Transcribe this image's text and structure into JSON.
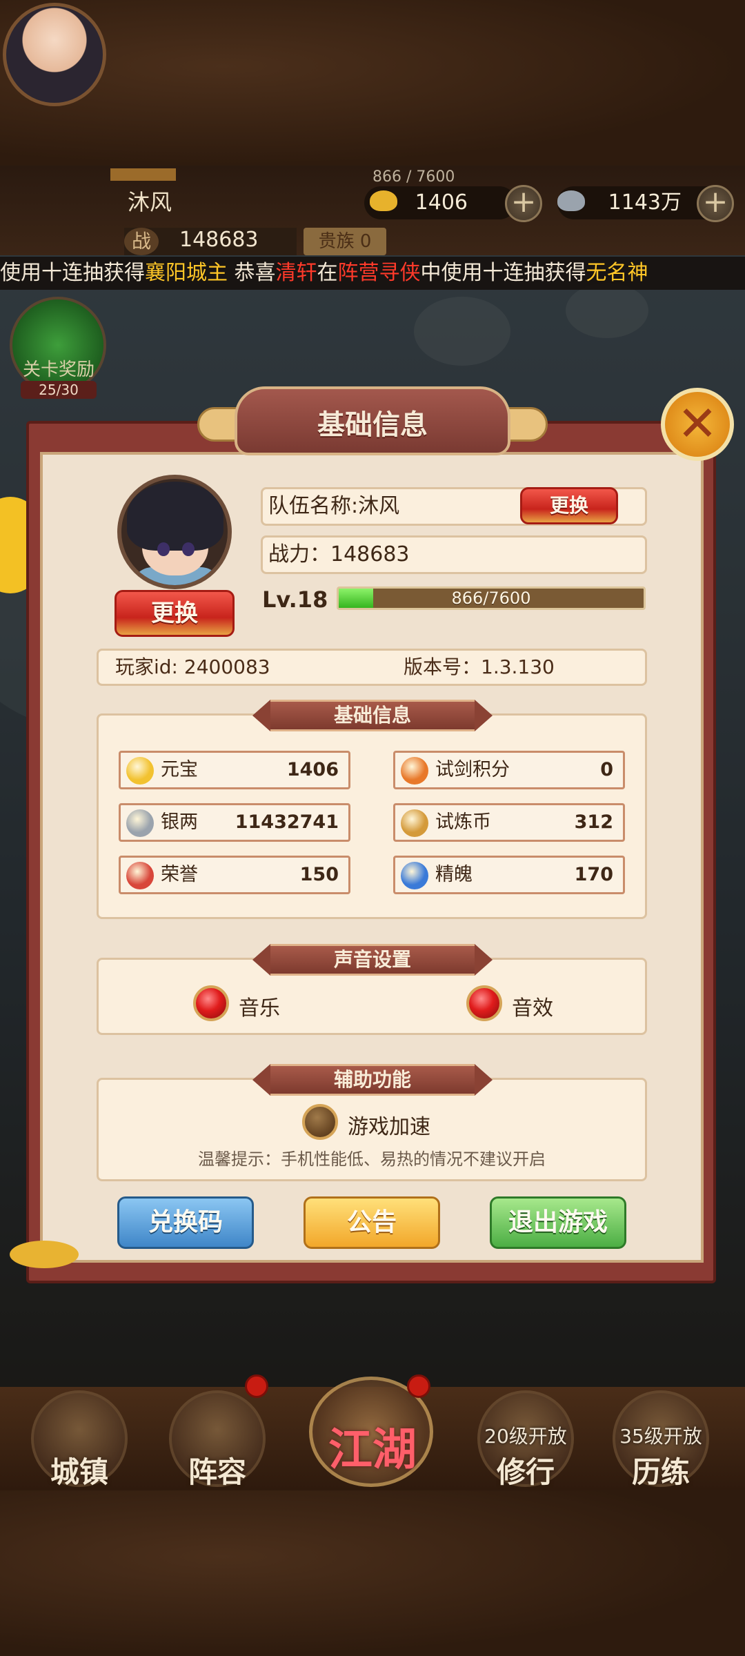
{
  "hud": {
    "player_name": "沐风",
    "exp_text": "866 / 7600",
    "gold": "1406",
    "silver": "1143万",
    "power_label": "战",
    "power_value": "148683",
    "noble_label": "贵族 0",
    "ticker_parts": [
      "使用十连抽获得",
      "襄阳城主",
      "    恭喜",
      "清轩",
      "在",
      "阵营寻侠",
      "中使用十连抽获得",
      "无名神"
    ]
  },
  "side": {
    "exp_label": "关卡奖励",
    "exp_count": "25/30"
  },
  "modal": {
    "title": "基础信息",
    "close_icon": "✕",
    "portrait_change_label": "更换",
    "team_name": "队伍名称:沐风",
    "team_change_label": "更换",
    "power": "战力：148683",
    "level": "Lv.18",
    "xp_text": "866/7600",
    "xp_fraction": 0.114,
    "player_id": "玩家id: 2400083",
    "version": "版本号：1.3.130",
    "basic_section_title": "基础信息",
    "resources": [
      {
        "name": "元宝",
        "value": "1406",
        "icon": "gold-ingot-icon",
        "color": "#f2c230"
      },
      {
        "name": "试剑积分",
        "value": "0",
        "icon": "sword-trial-icon",
        "color": "#e8782a"
      },
      {
        "name": "银两",
        "value": "11432741",
        "icon": "silver-ingot-icon",
        "color": "#9aa3ad"
      },
      {
        "name": "试炼币",
        "value": "312",
        "icon": "trial-coin-icon",
        "color": "#d49a3a"
      },
      {
        "name": "荣誉",
        "value": "150",
        "icon": "honor-icon",
        "color": "#d8463a"
      },
      {
        "name": "精魄",
        "value": "170",
        "icon": "soul-icon",
        "color": "#3a7ad8"
      }
    ],
    "sound_section_title": "声音设置",
    "music_label": "音乐",
    "sfx_label": "音效",
    "assist_section_title": "辅助功能",
    "speedup_label": "游戏加速",
    "hint": "温馨提示：手机性能低、易热的情况不建议开启",
    "redeem_label": "兑换码",
    "notice_label": "公告",
    "logout_label": "退出游戏"
  },
  "nav": {
    "town": "城镇",
    "lineup": "阵容",
    "jianghu": "江湖",
    "practice": "修行",
    "practice_lock": "20级开放",
    "training": "历练",
    "training_lock": "35级开放"
  }
}
